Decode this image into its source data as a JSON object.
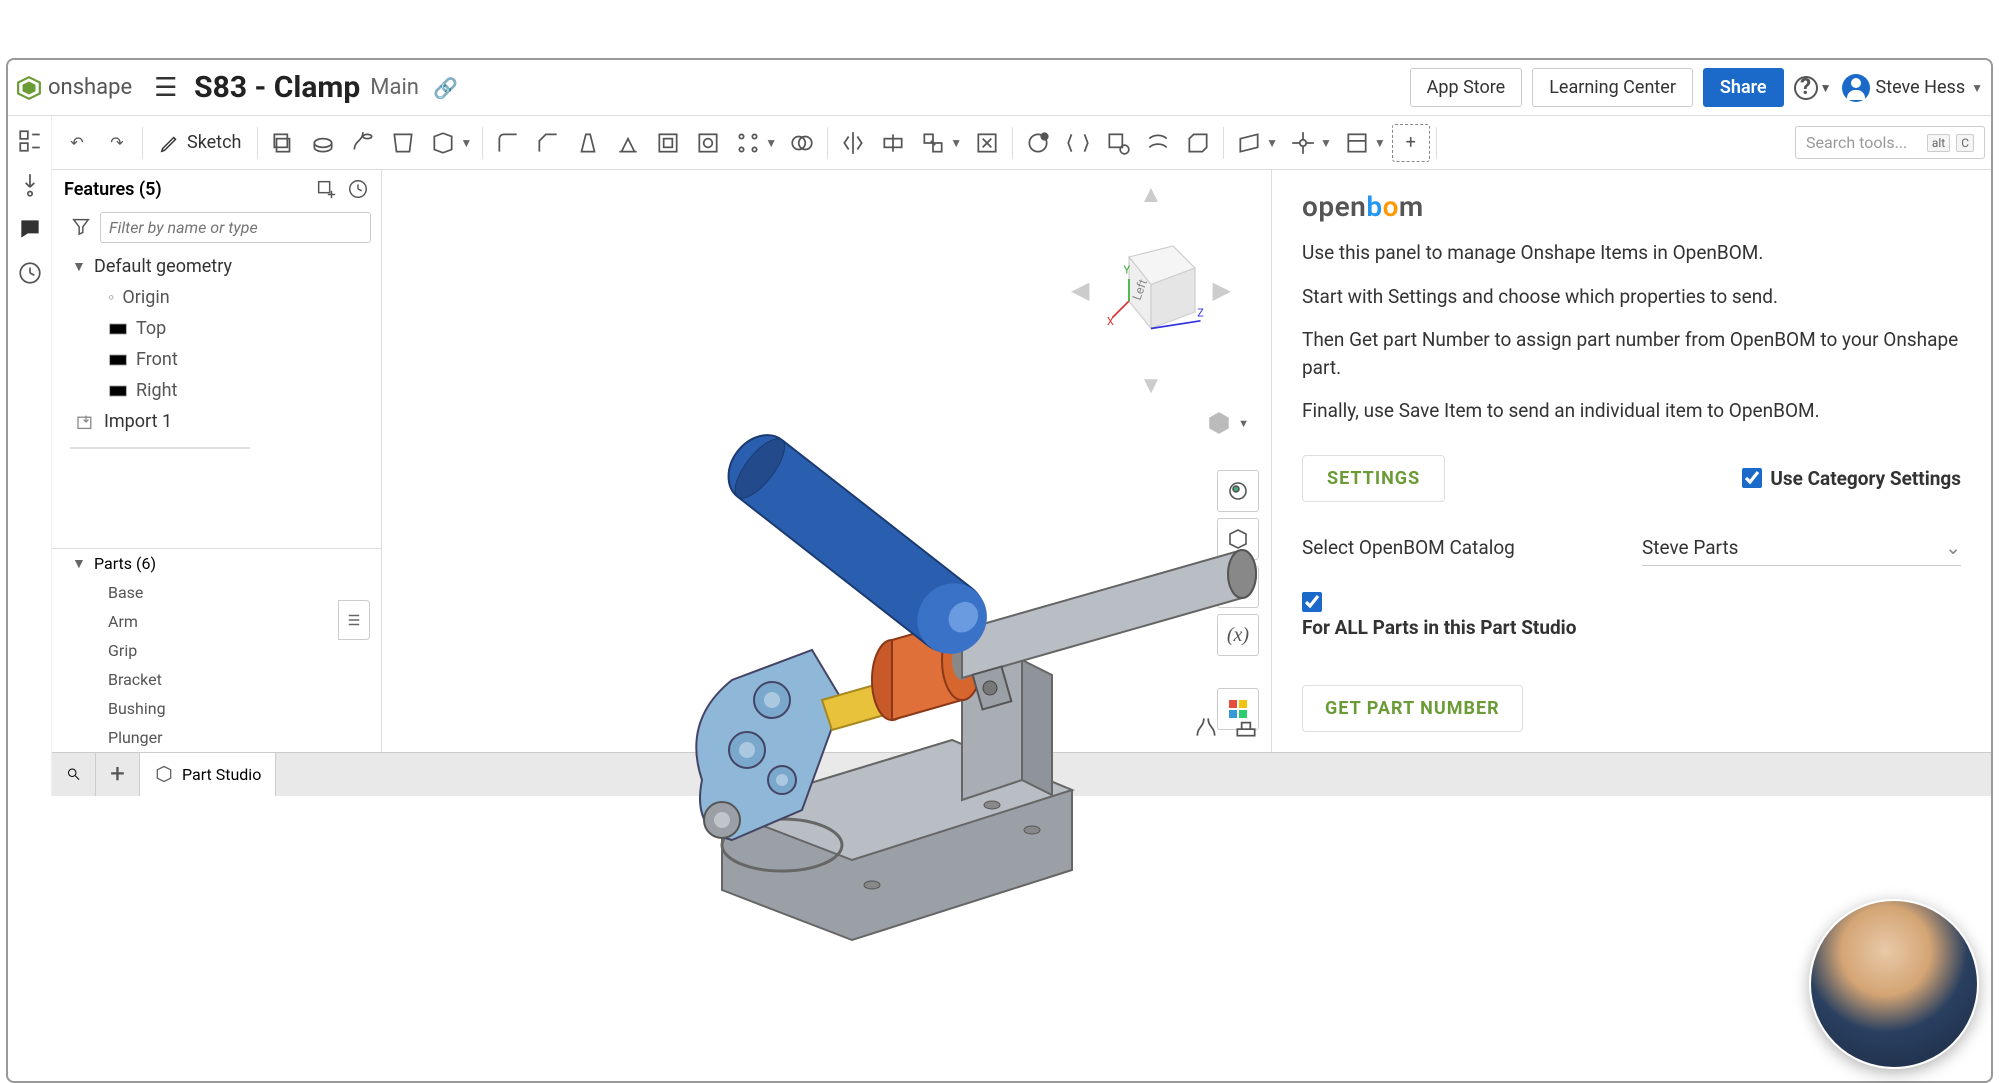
{
  "header": {
    "brand": "onshape",
    "doc_title": "S83 - Clamp",
    "doc_sub": "Main",
    "buttons": {
      "app_store": "App Store",
      "learning": "Learning Center",
      "share": "Share"
    },
    "user": "Steve Hess"
  },
  "toolbar": {
    "sketch": "Sketch",
    "search_placeholder": "Search tools...",
    "search_hint1": "alt",
    "search_hint2": "C"
  },
  "features": {
    "title": "Features (5)",
    "filter_placeholder": "Filter by name or type",
    "default_geometry": "Default geometry",
    "items": [
      "Origin",
      "Top",
      "Front",
      "Right"
    ],
    "import": "Import 1"
  },
  "parts": {
    "title": "Parts (6)",
    "items": [
      "Base",
      "Arm",
      "Grip",
      "Bracket",
      "Bushing",
      "Plunger"
    ]
  },
  "openbom": {
    "intro1": "Use this panel to manage Onshape Items in OpenBOM.",
    "intro2": "Start with Settings and choose which properties to send.",
    "intro3": "Then Get part Number to assign part number from OpenBOM to your Onshape part.",
    "intro4": "Finally, use Save Item to send an individual item to OpenBOM.",
    "settings": "SETTINGS",
    "use_category": "Use Category Settings",
    "catalog_label": "Select OpenBOM Catalog",
    "catalog_value": "Steve Parts",
    "all_parts": "For ALL Parts in this Part Studio",
    "get_pn": "GET PART NUMBER"
  },
  "footer": {
    "tab": "Part Studio"
  }
}
